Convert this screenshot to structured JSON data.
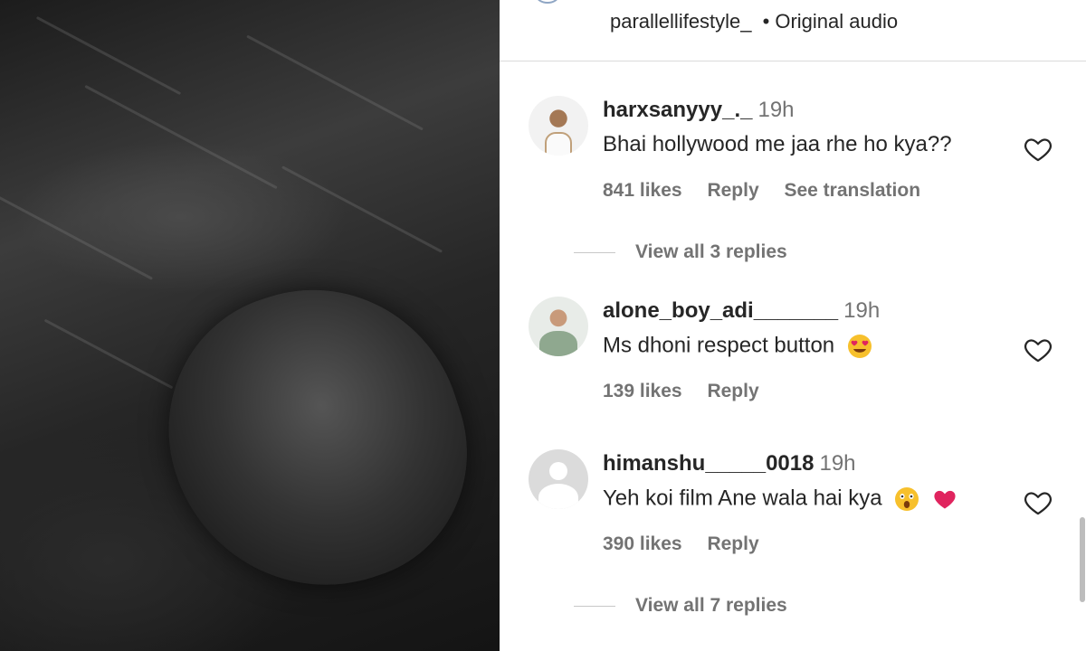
{
  "header": {
    "username": "parallellifestyle_",
    "separator": "•",
    "audio_label": "Original audio"
  },
  "comments": [
    {
      "username": "harxsanyyy_._",
      "time": "19h",
      "text": "Bhai hollywood me jaa rhe ho kya??",
      "likes": "841 likes",
      "reply": "Reply",
      "translate": "See translation",
      "view_replies": "View all 3 replies"
    },
    {
      "username": "alone_boy_adi_______",
      "time": "19h",
      "text": "Ms dhoni respect button",
      "emoji": "heart-eyes",
      "likes": "139 likes",
      "reply": "Reply"
    },
    {
      "username": "himanshu_____0018",
      "time": "19h",
      "text": "Yeh koi film Ane wala hai kya",
      "emoji": [
        "astonished-face",
        "red-heart"
      ],
      "likes": "390 likes",
      "reply": "Reply",
      "view_replies": "View all 7 replies"
    }
  ],
  "icons": {
    "like": "heart-outline-icon",
    "avatar_placeholder": "default-avatar-icon"
  },
  "colors": {
    "text_primary": "#262626",
    "text_secondary": "#737373",
    "divider": "#dbdbdb"
  }
}
